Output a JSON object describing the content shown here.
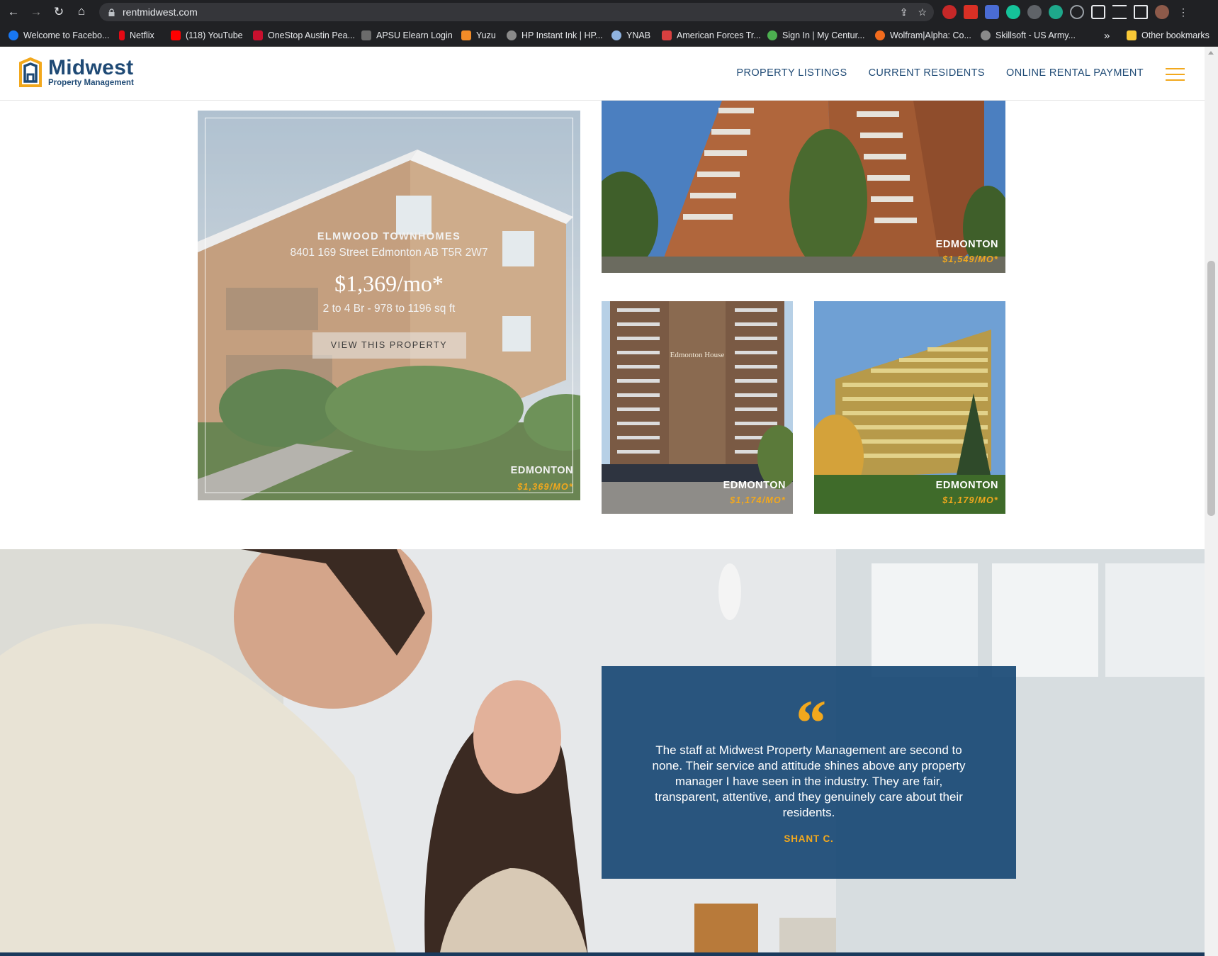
{
  "browser": {
    "url": "rentmidwest.com",
    "bookmarks": [
      {
        "label": "Welcome to Facebo...",
        "color": "#1877f2"
      },
      {
        "label": "Netflix",
        "color": "#e50914"
      },
      {
        "label": "(118) YouTube",
        "color": "#ff0000"
      },
      {
        "label": "OneStop Austin Pea...",
        "color": "#c8102e"
      },
      {
        "label": "APSU Elearn Login",
        "color": "#6b6b6b"
      },
      {
        "label": "Yuzu",
        "color": "#f28c28"
      },
      {
        "label": "HP Instant Ink | HP...",
        "color": "#8a8a8a"
      },
      {
        "label": "YNAB",
        "color": "#8fb3e0"
      },
      {
        "label": "American Forces Tr...",
        "color": "#d94040"
      },
      {
        "label": "Sign In | My Centur...",
        "color": "#4caf50"
      },
      {
        "label": "Wolfram|Alpha: Co...",
        "color": "#f26b1d"
      },
      {
        "label": "Skillsoft - US Army...",
        "color": "#8a8a8a"
      }
    ],
    "overflow": "»",
    "other_bookmarks": "Other bookmarks"
  },
  "site": {
    "logo_name": "Midwest",
    "logo_sub": "Property Management",
    "nav": [
      "PROPERTY LISTINGS",
      "CURRENT RESIDENTS",
      "ONLINE RENTAL PAYMENT"
    ]
  },
  "featured": {
    "name": "ELMWOOD TOWNHOMES",
    "address": "8401 169 Street Edmonton AB T5R 2W7",
    "price": "$1,369/mo*",
    "size": "2 to 4 Br - 978 to 1196 sq ft",
    "button": "VIEW THIS PROPERTY",
    "city": "EDMONTON",
    "price_tag": "$1,369/MO*"
  },
  "listings": [
    {
      "city": "EDMONTON",
      "price": "$1,549/MO*"
    },
    {
      "city": "EDMONTON",
      "price": "$1,174/MO*",
      "sign": "Edmonton House"
    },
    {
      "city": "EDMONTON",
      "price": "$1,179/MO*"
    }
  ],
  "testimonial": {
    "quote_mark": "“",
    "text": "The staff at Midwest Property Management are second to none. Their service and attitude shines above any property manager I have seen in the industry. They are fair, transparent, attentive, and they genuinely care about their residents.",
    "author": "SHANT C."
  },
  "colors": {
    "brand_navy": "#1f4a75",
    "accent_gold": "#f2a81d",
    "testimonial_bg": "#1a4975"
  }
}
